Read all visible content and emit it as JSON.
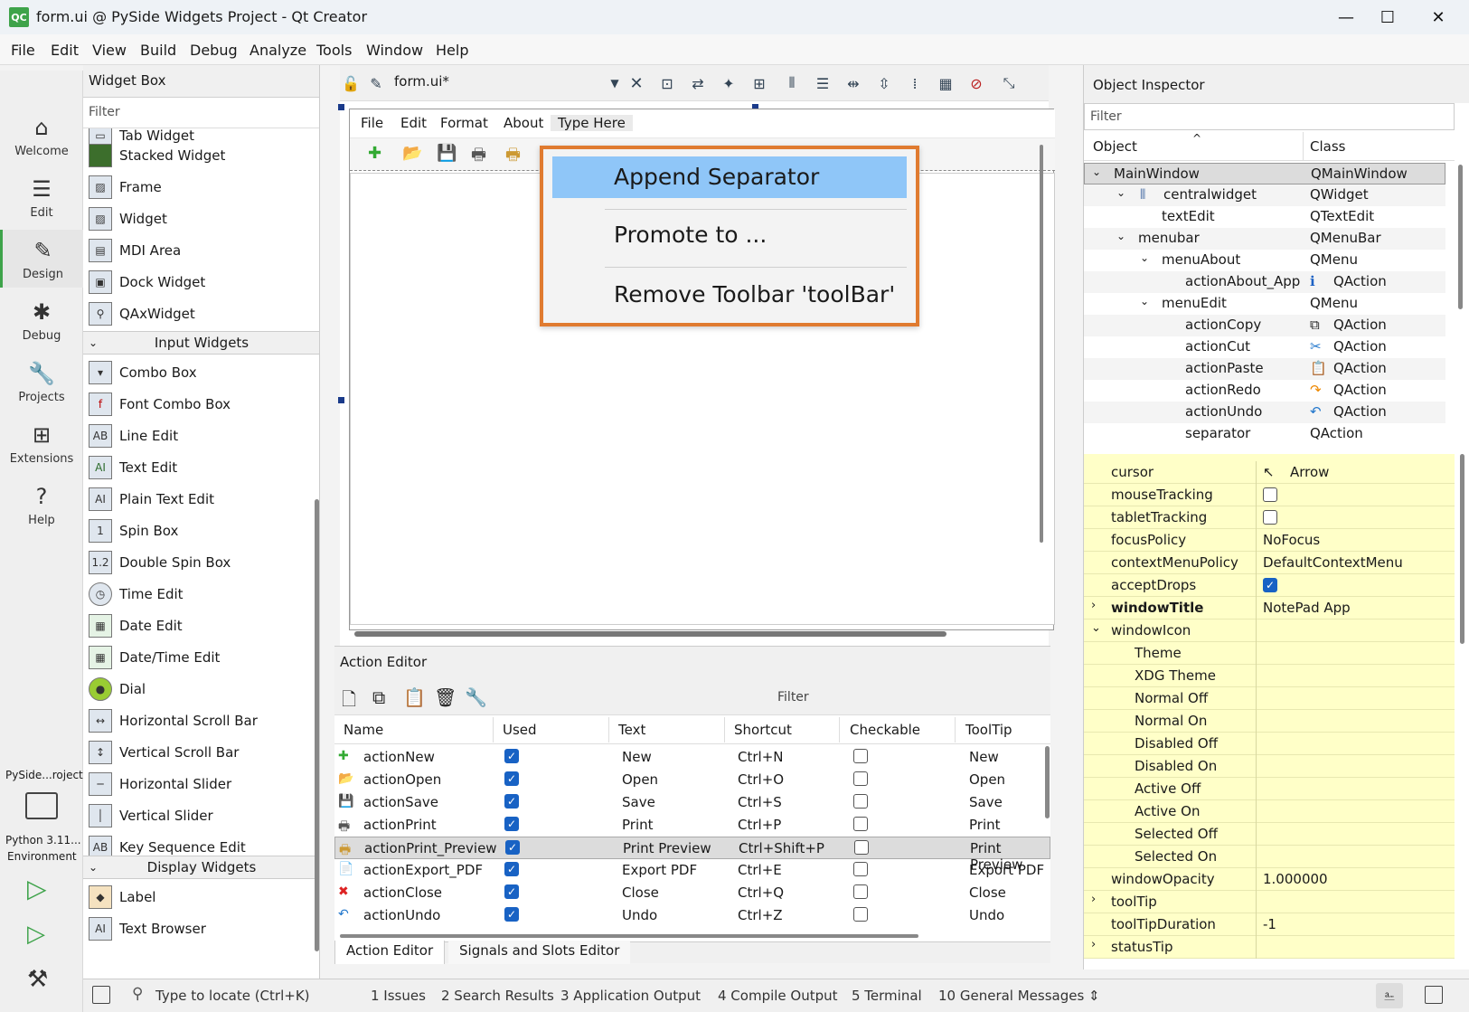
{
  "window": {
    "title": "form.ui @ PySide Widgets Project - Qt Creator",
    "logo": "QC"
  },
  "menubar": [
    "File",
    "Edit",
    "View",
    "Build",
    "Debug",
    "Analyze",
    "Tools",
    "Window",
    "Help"
  ],
  "modes": [
    {
      "label": "Welcome",
      "icon": "home-icon",
      "glyph": "⌂"
    },
    {
      "label": "Edit",
      "icon": "edit-icon",
      "glyph": "☰"
    },
    {
      "label": "Design",
      "icon": "pen-icon",
      "glyph": "✎"
    },
    {
      "label": "Debug",
      "icon": "bug-icon",
      "glyph": "✱"
    },
    {
      "label": "Projects",
      "icon": "wrench-icon",
      "glyph": "🔧"
    },
    {
      "label": "Extensions",
      "icon": "extensions-icon",
      "glyph": "⊞"
    },
    {
      "label": "Help",
      "icon": "help-icon",
      "glyph": "?"
    }
  ],
  "kit": {
    "project": "PySide...roject",
    "env_line1": "Python 3.11...",
    "env_line2": "Environment"
  },
  "widget_box": {
    "title": "Widget Box",
    "filter_placeholder": "Filter",
    "partial_top": "Tab Widget",
    "items_a": [
      "Stacked Widget",
      "Frame",
      "Widget",
      "MDI Area",
      "Dock Widget",
      "QAxWidget"
    ],
    "cat_input": "Input Widgets",
    "items_b": [
      "Combo Box",
      "Font Combo Box",
      "Line Edit",
      "Text Edit",
      "Plain Text Edit",
      "Spin Box",
      "Double Spin Box",
      "Time Edit",
      "Date Edit",
      "Date/Time Edit",
      "Dial",
      "Horizontal Scroll Bar",
      "Vertical Scroll Bar",
      "Horizontal Slider",
      "Vertical Slider",
      "Key Sequence Edit"
    ],
    "cat_display": "Display Widgets",
    "items_c": [
      "Label",
      "Text Browser"
    ]
  },
  "form_toolbar": {
    "file": "form.ui*"
  },
  "form": {
    "menu": [
      "File",
      "Edit",
      "Format",
      "About",
      "Type Here"
    ]
  },
  "context_menu": [
    "Append Separator",
    "Promote to ...",
    "Remove Toolbar 'toolBar'"
  ],
  "action_editor": {
    "title": "Action Editor",
    "filter_placeholder": "Filter",
    "columns": [
      "Name",
      "Used",
      "Text",
      "Shortcut",
      "Checkable",
      "ToolTip"
    ],
    "rows": [
      {
        "name": "actionNew",
        "text": "New",
        "shortcut": "Ctrl+N",
        "tooltip": "New",
        "icon": "new-icon",
        "glyph": "✚"
      },
      {
        "name": "actionOpen",
        "text": "Open",
        "shortcut": "Ctrl+O",
        "tooltip": "Open",
        "icon": "open-folder-icon",
        "glyph": "📂"
      },
      {
        "name": "actionSave",
        "text": "Save",
        "shortcut": "Ctrl+S",
        "tooltip": "Save",
        "icon": "save-icon",
        "glyph": "💾"
      },
      {
        "name": "actionPrint",
        "text": "Print",
        "shortcut": "Ctrl+P",
        "tooltip": "Print",
        "icon": "print-icon",
        "glyph": "🖶"
      },
      {
        "name": "actionPrint_Preview",
        "text": "Print Preview",
        "shortcut": "Ctrl+Shift+P",
        "tooltip": "Print Preview",
        "icon": "print-preview-icon",
        "glyph": "🖶"
      },
      {
        "name": "actionExport_PDF",
        "text": "Export PDF",
        "shortcut": "Ctrl+E",
        "tooltip": "Export PDF",
        "icon": "pdf-icon",
        "glyph": "📄"
      },
      {
        "name": "actionClose",
        "text": "Close",
        "shortcut": "Ctrl+Q",
        "tooltip": "Close",
        "icon": "close-circle-icon",
        "glyph": "✖"
      },
      {
        "name": "actionUndo",
        "text": "Undo",
        "shortcut": "Ctrl+Z",
        "tooltip": "Undo",
        "icon": "undo-icon",
        "glyph": "↶"
      }
    ],
    "tabs": [
      "Action Editor",
      "Signals and Slots Editor"
    ]
  },
  "object_inspector": {
    "title": "Object Inspector",
    "filter_placeholder": "Filter",
    "columns": [
      "Object",
      "Class"
    ],
    "rows": [
      {
        "obj": "MainWindow",
        "cls": "QMainWindow",
        "indent": 0,
        "exp": "⌄"
      },
      {
        "obj": "centralwidget",
        "cls": "QWidget",
        "indent": 1,
        "exp": "⌄"
      },
      {
        "obj": "textEdit",
        "cls": "QTextEdit",
        "indent": 2,
        "exp": ""
      },
      {
        "obj": "menubar",
        "cls": "QMenuBar",
        "indent": 1,
        "exp": "⌄"
      },
      {
        "obj": "menuAbout",
        "cls": "QMenu",
        "indent": 2,
        "exp": "⌄"
      },
      {
        "obj": "actionAbout_App",
        "cls": "QAction",
        "indent": 3,
        "exp": ""
      },
      {
        "obj": "menuEdit",
        "cls": "QMenu",
        "indent": 2,
        "exp": "⌄"
      },
      {
        "obj": "actionCopy",
        "cls": "QAction",
        "indent": 3,
        "exp": ""
      },
      {
        "obj": "actionCut",
        "cls": "QAction",
        "indent": 3,
        "exp": ""
      },
      {
        "obj": "actionPaste",
        "cls": "QAction",
        "indent": 3,
        "exp": ""
      },
      {
        "obj": "actionRedo",
        "cls": "QAction",
        "indent": 3,
        "exp": ""
      },
      {
        "obj": "actionUndo",
        "cls": "QAction",
        "indent": 3,
        "exp": ""
      },
      {
        "obj": "separator",
        "cls": "QAction",
        "indent": 3,
        "exp": ""
      }
    ]
  },
  "properties": [
    {
      "name": "cursor",
      "value": "Arrow",
      "type": "text"
    },
    {
      "name": "mouseTracking",
      "value": "",
      "type": "check",
      "on": false
    },
    {
      "name": "tabletTracking",
      "value": "",
      "type": "check",
      "on": false
    },
    {
      "name": "focusPolicy",
      "value": "NoFocus",
      "type": "text"
    },
    {
      "name": "contextMenuPolicy",
      "value": "DefaultContextMenu",
      "type": "text"
    },
    {
      "name": "acceptDrops",
      "value": "",
      "type": "check",
      "on": true
    },
    {
      "name": "windowTitle",
      "value": "NotePad App",
      "type": "text",
      "bold": true,
      "exp": "›"
    },
    {
      "name": "windowIcon",
      "value": "",
      "type": "text",
      "exp": "⌄"
    },
    {
      "name": "Theme",
      "value": "",
      "type": "text",
      "sub": true
    },
    {
      "name": "XDG Theme",
      "value": "",
      "type": "text",
      "sub": true
    },
    {
      "name": "Normal Off",
      "value": "",
      "type": "text",
      "sub": true
    },
    {
      "name": "Normal On",
      "value": "",
      "type": "text",
      "sub": true
    },
    {
      "name": "Disabled Off",
      "value": "",
      "type": "text",
      "sub": true
    },
    {
      "name": "Disabled On",
      "value": "",
      "type": "text",
      "sub": true
    },
    {
      "name": "Active Off",
      "value": "",
      "type": "text",
      "sub": true
    },
    {
      "name": "Active On",
      "value": "",
      "type": "text",
      "sub": true
    },
    {
      "name": "Selected Off",
      "value": "",
      "type": "text",
      "sub": true
    },
    {
      "name": "Selected On",
      "value": "",
      "type": "text",
      "sub": true
    },
    {
      "name": "windowOpacity",
      "value": "1.000000",
      "type": "text"
    },
    {
      "name": "toolTip",
      "value": "",
      "type": "text",
      "exp": "›"
    },
    {
      "name": "toolTipDuration",
      "value": "-1",
      "type": "text"
    },
    {
      "name": "statusTip",
      "value": "",
      "type": "text",
      "exp": "›"
    }
  ],
  "statusbar": {
    "locate_placeholder": "Type to locate (Ctrl+K)",
    "panes": [
      "1  Issues",
      "2  Search Results",
      "3  Application Output",
      "4  Compile Output",
      "5  Terminal",
      "10  General Messages"
    ]
  }
}
